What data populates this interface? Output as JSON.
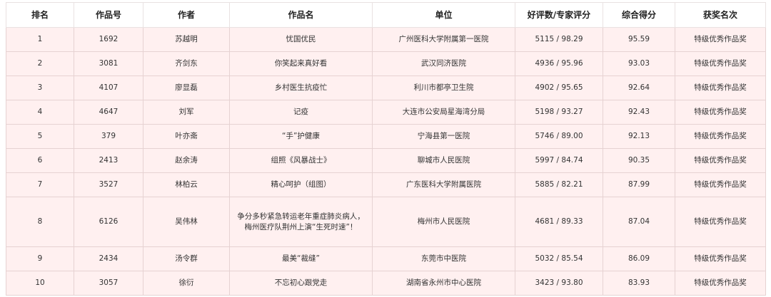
{
  "table": {
    "headers": [
      "排名",
      "作品号",
      "作者",
      "作品名",
      "单位",
      "好评数/专家评分",
      "综合得分",
      "获奖名次"
    ],
    "rows": [
      [
        "1",
        "1692",
        "苏越明",
        "忧国优民",
        "广州医科大学附属第一医院",
        "5115 / 98.29",
        "95.59",
        "特级优秀作品奖"
      ],
      [
        "2",
        "3081",
        "齐剑东",
        "你笑起来真好看",
        "武汉同济医院",
        "4936 / 95.96",
        "93.03",
        "特级优秀作品奖"
      ],
      [
        "3",
        "4107",
        "廖显磊",
        "乡村医生抗疫忙",
        "利川市都亭卫生院",
        "4902 / 95.65",
        "92.64",
        "特级优秀作品奖"
      ],
      [
        "4",
        "4647",
        "刘军",
        "记疫",
        "大连市公安局星海湾分局",
        "5198 / 93.27",
        "92.43",
        "特级优秀作品奖"
      ],
      [
        "5",
        "379",
        "叶亦斋",
        "“手”护健康",
        "宁海县第一医院",
        "5746 / 89.00",
        "92.13",
        "特级优秀作品奖"
      ],
      [
        "6",
        "2413",
        "赵余涛",
        "组照《风暴战士》",
        "聊城市人民医院",
        "5997 / 84.74",
        "90.35",
        "特级优秀作品奖"
      ],
      [
        "7",
        "3527",
        "林柏云",
        "精心呵护（组图）",
        "广东医科大学附属医院",
        "5885 / 82.21",
        "87.99",
        "特级优秀作品奖"
      ],
      [
        "8",
        "6126",
        "吴伟林",
        "争分多秒紧急转运老年重症肺炎病人，梅州医疗队荆州上演“生死时速”！",
        "梅州市人民医院",
        "4681 / 89.33",
        "87.04",
        "特级优秀作品奖"
      ],
      [
        "9",
        "2434",
        "汤令群",
        "最美“裁缝”",
        "东莞市中医院",
        "5032 / 85.54",
        "86.09",
        "特级优秀作品奖"
      ],
      [
        "10",
        "3057",
        "徐衍",
        "不忘初心跟党走",
        "湖南省永州市中心医院",
        "3423 / 93.80",
        "83.93",
        "特级优秀作品奖"
      ]
    ]
  },
  "colors": {
    "row_background": "#fff0f0",
    "border": "#e6d2d2",
    "header_background": "#ffffff"
  }
}
